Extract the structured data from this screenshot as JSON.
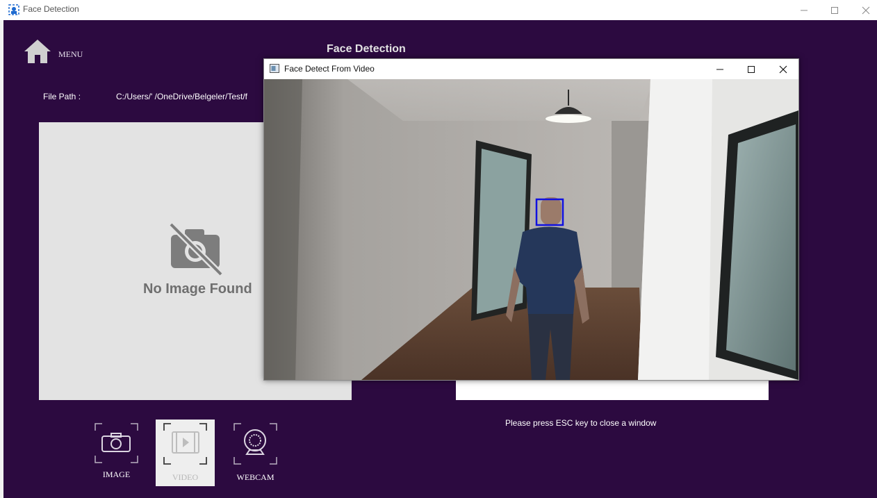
{
  "app": {
    "title": "Face Detection",
    "icon": "face-detection-app-icon"
  },
  "window_controls": {
    "minimize": "minimize-icon",
    "maximize": "maximize-icon",
    "close": "close-icon"
  },
  "header": {
    "menu_label": "MENU",
    "menu_icon": "home-icon",
    "page_title": "Face Detection"
  },
  "file_path": {
    "label": "File Path :",
    "value": "C:/Users/'       /OneDrive/Belgeler/Test/f"
  },
  "image_panel": {
    "placeholder_text": "No Image Found",
    "placeholder_icon": "no-camera-icon"
  },
  "modes": [
    {
      "label": "IMAGE",
      "icon": "camera-icon",
      "selected": false
    },
    {
      "label": "VIDEO",
      "icon": "video-film-icon",
      "selected": true
    },
    {
      "label": "WEBCAM",
      "icon": "webcam-icon",
      "selected": false
    }
  ],
  "hint": "Please press ESC key to close a window",
  "video_window": {
    "title": "Face Detect From Video",
    "icon": "video-window-icon",
    "face_box_color": "#1010e0"
  },
  "colors": {
    "background": "#2c0a40",
    "panel": "#e3e3e3",
    "selected_mode": "#eeeeee"
  }
}
